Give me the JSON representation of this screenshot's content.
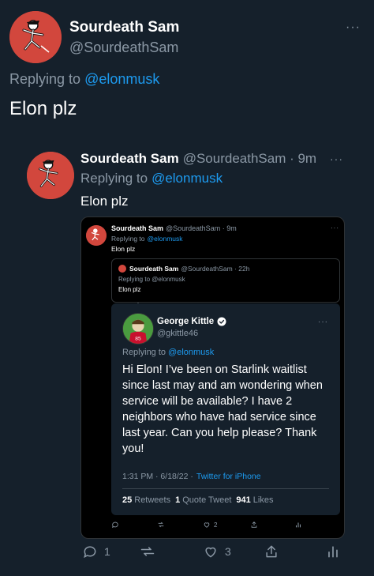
{
  "main_tweet": {
    "name": "Sourdeath Sam",
    "handle": "@SourdeathSam",
    "replying_prefix": "Replying to",
    "replying_to": "@elonmusk",
    "text": "Elon plz",
    "more": "···"
  },
  "quoted_tweet": {
    "name": "Sourdeath Sam",
    "handle_time": "@SourdeathSam · 9m",
    "replying_prefix": "Replying to",
    "replying_to": "@elonmusk",
    "text": "Elon plz",
    "more": "···"
  },
  "screenshot": {
    "tweet": {
      "name": "Sourdeath Sam",
      "handle_time": "@SourdeathSam · 9m",
      "replying_prefix": "Replying to",
      "replying_to": "@elonmusk",
      "text": "Elon plz",
      "more": "···"
    },
    "inner_tweet": {
      "name": "Sourdeath Sam",
      "handle_time": "@SourdeathSam · 22h",
      "replying": "Replying to @elonmusk",
      "text": "Elon plz"
    },
    "george_tweet": {
      "name": "George Kittle",
      "handle": "@gkittle46",
      "verified_icon": "verified-badge-icon",
      "replying_prefix": "Replying to",
      "replying_to": "@elonmusk",
      "text": "Hi Elon! I’ve been on Starlink waitlist since last may and am wondering when service will be available? I have 2 neighbors who have had service since last year. Can you help please? Thank you!",
      "time_date": "1:31 PM · 6/18/22 ·",
      "source": "Twitter for iPhone",
      "more": "···",
      "stats": {
        "retweets_count": "25",
        "retweets_label": "Retweets",
        "quotes_count": "1",
        "quotes_label": "Quote Tweet",
        "likes_count": "941",
        "likes_label": "Likes"
      }
    },
    "actions": {
      "like_count": "2"
    }
  },
  "actions": {
    "reply_count": "1",
    "like_count": "3"
  },
  "colors": {
    "background": "#15202b",
    "link": "#1d9bf0",
    "muted": "#8b98a5",
    "avatar": "#d2473d"
  }
}
